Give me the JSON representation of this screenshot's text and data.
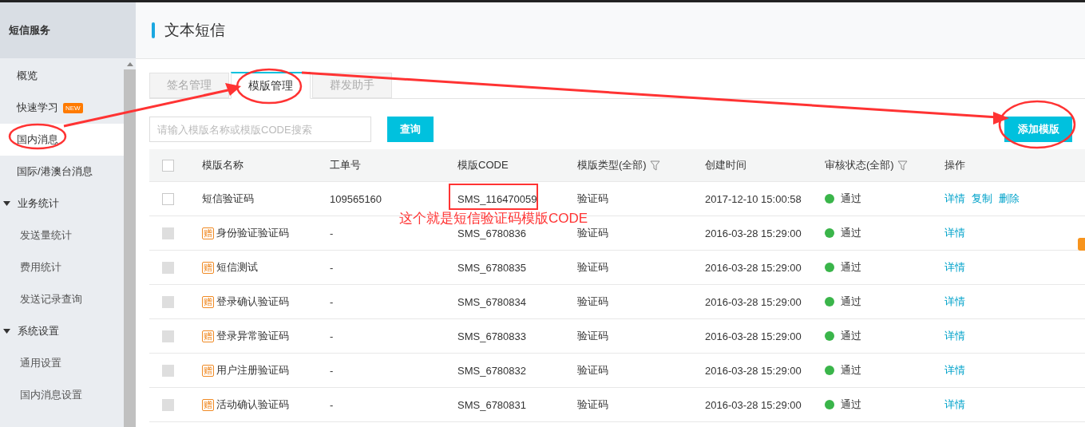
{
  "sidebar": {
    "title": "短信服务",
    "items": [
      {
        "label": "概览",
        "selected": false
      },
      {
        "label": "快速学习",
        "selected": false,
        "badge": "NEW"
      },
      {
        "label": "国内消息",
        "selected": true
      },
      {
        "label": "国际/港澳台消息",
        "selected": false
      },
      {
        "label": "业务统计",
        "expanded": true,
        "children": [
          {
            "label": "发送量统计",
            "selected": false
          },
          {
            "label": "费用统计",
            "selected": false
          },
          {
            "label": "发送记录查询",
            "selected": false
          }
        ]
      },
      {
        "label": "系统设置",
        "expanded": true,
        "children": [
          {
            "label": "通用设置",
            "selected": false
          },
          {
            "label": "国内消息设置",
            "selected": false
          }
        ]
      }
    ]
  },
  "page_title": "文本短信",
  "tabs": [
    {
      "label": "签名管理",
      "selected": false
    },
    {
      "label": "模版管理",
      "selected": true
    },
    {
      "label": "群发助手",
      "selected": false
    }
  ],
  "search": {
    "placeholder": "请输入模版名称或模版CODE搜索",
    "button": "查询"
  },
  "add_button": "添加模版",
  "table": {
    "select_all_checked": false,
    "columns": [
      {
        "label": "模版名称",
        "filter": false
      },
      {
        "label": "工单号",
        "filter": false
      },
      {
        "label": "模版CODE",
        "filter": false
      },
      {
        "label": "模版类型(全部)",
        "filter": true
      },
      {
        "label": "创建时间",
        "filter": false
      },
      {
        "label": "审核状态(全部)",
        "filter": true
      },
      {
        "label": "操作",
        "filter": false
      }
    ],
    "rows": [
      {
        "disabled": false,
        "name": "短信验证码",
        "order": "109565160",
        "code": "SMS_116470059",
        "type": "验证码",
        "created": "2017-12-10 15:00:58",
        "status": "通过",
        "color": "#3ab54a",
        "actions": [
          "详情",
          "复制",
          "删除"
        ]
      },
      {
        "disabled": true,
        "badge": "赠",
        "name": "身份验证验证码",
        "order": "-",
        "code": "SMS_6780836",
        "type": "验证码",
        "created": "2016-03-28 15:29:00",
        "status": "通过",
        "color": "#3ab54a",
        "actions": [
          "详情"
        ]
      },
      {
        "disabled": true,
        "badge": "赠",
        "name": "短信测试",
        "order": "-",
        "code": "SMS_6780835",
        "type": "验证码",
        "created": "2016-03-28 15:29:00",
        "status": "通过",
        "color": "#3ab54a",
        "actions": [
          "详情"
        ]
      },
      {
        "disabled": true,
        "badge": "赠",
        "name": "登录确认验证码",
        "order": "-",
        "code": "SMS_6780834",
        "type": "验证码",
        "created": "2016-03-28 15:29:00",
        "status": "通过",
        "color": "#3ab54a",
        "actions": [
          "详情"
        ]
      },
      {
        "disabled": true,
        "badge": "赠",
        "name": "登录异常验证码",
        "order": "-",
        "code": "SMS_6780833",
        "type": "验证码",
        "created": "2016-03-28 15:29:00",
        "status": "通过",
        "color": "#3ab54a",
        "actions": [
          "详情"
        ]
      },
      {
        "disabled": true,
        "badge": "赠",
        "name": "用户注册验证码",
        "order": "-",
        "code": "SMS_6780832",
        "type": "验证码",
        "created": "2016-03-28 15:29:00",
        "status": "通过",
        "color": "#3ab54a",
        "actions": [
          "详情"
        ]
      },
      {
        "disabled": true,
        "badge": "赠",
        "name": "活动确认验证码",
        "order": "-",
        "code": "SMS_6780831",
        "type": "验证码",
        "created": "2016-03-28 15:29:00",
        "status": "通过",
        "color": "#3ab54a",
        "actions": [
          "详情"
        ]
      }
    ]
  },
  "annotation": {
    "note": "这个就是短信验证码模版CODE"
  }
}
